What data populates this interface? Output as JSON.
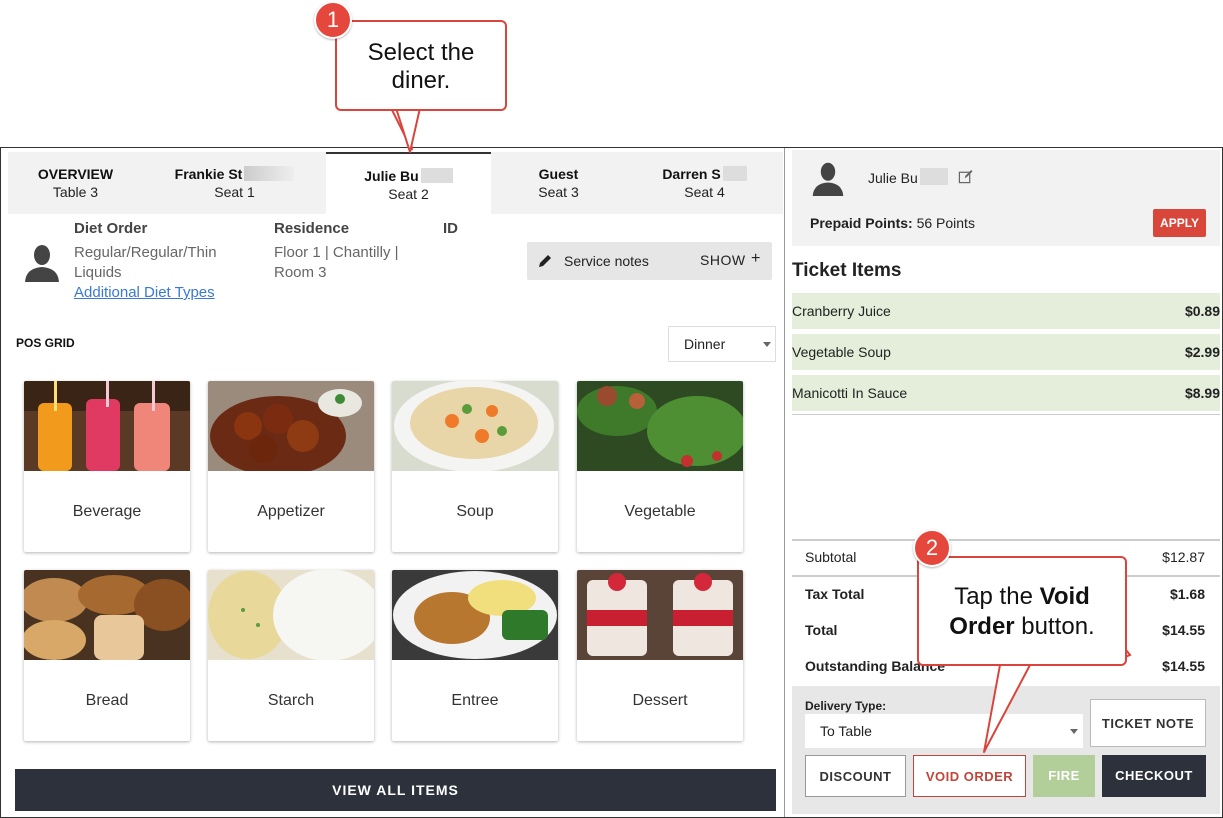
{
  "tabs": [
    {
      "name": "OVERVIEW",
      "sub": "Table 3"
    },
    {
      "name": "Frankie St",
      "sub": "Seat 1"
    },
    {
      "name": "Julie Bu",
      "sub": "Seat 2"
    },
    {
      "name": "Guest",
      "sub": "Seat 3"
    },
    {
      "name": "Darren S",
      "sub": "Seat 4"
    }
  ],
  "diner": {
    "diet_label": "Diet Order",
    "diet_value_1": "Regular/Regular/Thin",
    "diet_value_2": "Liquids",
    "diet_link": "Additional Diet Types",
    "residence_label": "Residence",
    "residence_value_1": "Floor 1 | Chantilly |",
    "residence_value_2": "Room 3",
    "id_label": "ID",
    "service_notes": "Service notes",
    "show": "SHOW"
  },
  "pos": {
    "label": "POS GRID",
    "meal": "Dinner",
    "categories": [
      "Beverage",
      "Appetizer",
      "Soup",
      "Vegetable",
      "Bread",
      "Starch",
      "Entree",
      "Dessert"
    ],
    "view_all": "VIEW ALL ITEMS"
  },
  "right": {
    "diner_name": "Julie Bu",
    "points_label": "Prepaid Points:",
    "points_value": "56 Points",
    "apply": "APPLY",
    "ticket_title": "Ticket Items",
    "items": [
      {
        "name": "Cranberry Juice",
        "price": "$0.89"
      },
      {
        "name": "Vegetable Soup",
        "price": "$2.99"
      },
      {
        "name": "Manicotti In Sauce",
        "price": "$8.99"
      }
    ],
    "subtotal_label": "Subtotal",
    "subtotal": "$12.87",
    "tax_label": "Tax Total",
    "tax": "$1.68",
    "total_label": "Total",
    "total": "$14.55",
    "balance_label": "Outstanding Balance",
    "balance": "$14.55",
    "delivery_label": "Delivery Type:",
    "delivery_value": "To Table",
    "ticket_note": "TICKET NOTE",
    "discount": "DISCOUNT",
    "void_order": "VOID ORDER",
    "fire": "FIRE",
    "checkout": "CHECKOUT"
  },
  "callouts": {
    "one_num": "1",
    "one_line1": "Select the",
    "one_line2": "diner.",
    "two_num": "2",
    "two_pre": "Tap the ",
    "two_bold1": "Void",
    "two_bold2": "Order",
    "two_post": " button."
  },
  "colors": {
    "accent_red": "#d9473b",
    "dark": "#2c313b",
    "ticket_green": "#e4eedb",
    "fire_green": "#b3cf99"
  }
}
